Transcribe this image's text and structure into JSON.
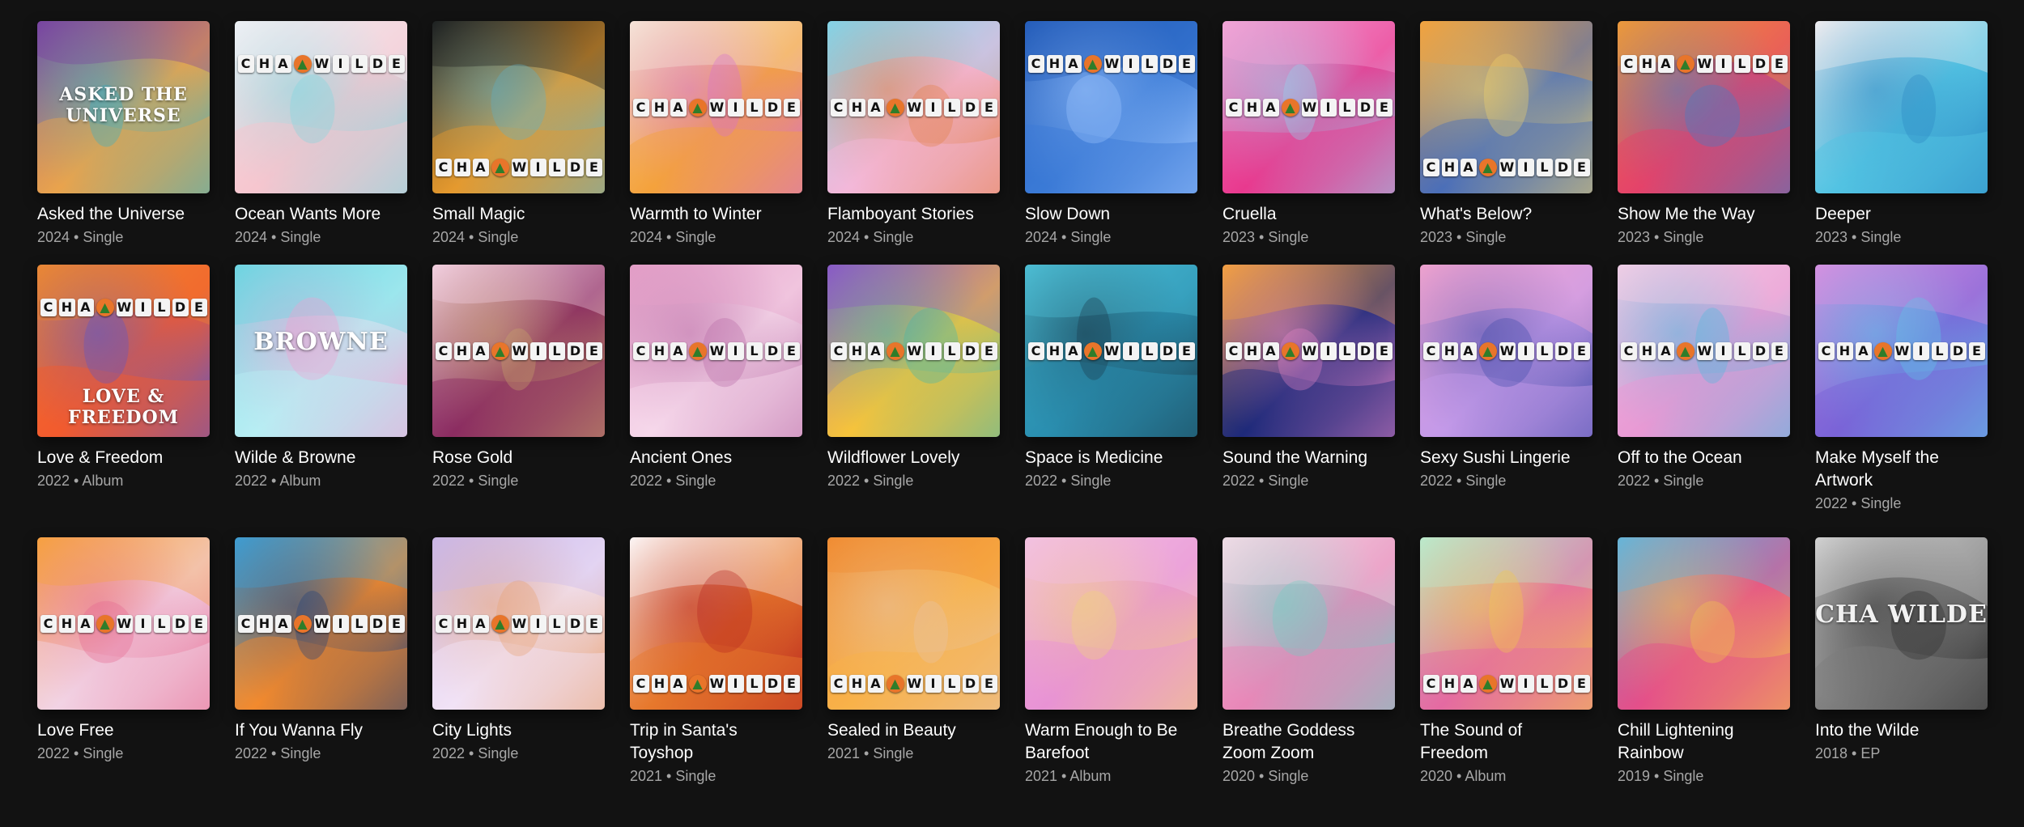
{
  "brand_logo_letters": [
    "C",
    "H",
    "A",
    "",
    "W",
    "I",
    "L",
    "D",
    "E"
  ],
  "albums": [
    {
      "title": "Asked the Universe",
      "meta": "2024 • Single",
      "art": {
        "c1": "#7b3fa0",
        "c2": "#e9a34d",
        "c3": "#35b3c9",
        "logo": false,
        "cover_text": "ASKED THE UNIVERSE"
      }
    },
    {
      "title": "Ocean Wants More",
      "meta": "2024 • Single",
      "art": {
        "c1": "#f2f2f5",
        "c2": "#f6c6cf",
        "c3": "#7fd7df",
        "logo": "top"
      }
    },
    {
      "title": "Small Magic",
      "meta": "2024 • Single",
      "art": {
        "c1": "#1b1b1b",
        "c2": "#e59a2f",
        "c3": "#5fb3c9",
        "logo": "bottom"
      }
    },
    {
      "title": "Warmth to Winter",
      "meta": "2024 • Single",
      "art": {
        "c1": "#f7e9d9",
        "c2": "#f4a23c",
        "c3": "#d66fd2",
        "logo": "mid"
      }
    },
    {
      "title": "Flamboyant Stories",
      "meta": "2024 • Single",
      "art": {
        "c1": "#7fd7ee",
        "c2": "#f3b8d9",
        "c3": "#e27f46",
        "logo": "mid"
      }
    },
    {
      "title": "Slow Down",
      "meta": "2024 • Single",
      "art": {
        "c1": "#1f58b6",
        "c2": "#3b7bd6",
        "c3": "#9ec6ff",
        "logo": "top"
      }
    },
    {
      "title": "Cruella",
      "meta": "2023 • Single",
      "art": {
        "c1": "#f6a2d6",
        "c2": "#e8398f",
        "c3": "#8fd6f0",
        "logo": "mid"
      }
    },
    {
      "title": "What's Below?",
      "meta": "2023 • Single",
      "art": {
        "c1": "#f2a13d",
        "c2": "#4c6fb8",
        "c3": "#f4d56a",
        "logo": "bottom"
      }
    },
    {
      "title": "Show Me the Way",
      "meta": "2023 • Single",
      "art": {
        "c1": "#f39a35",
        "c2": "#e4436a",
        "c3": "#3f7fc8",
        "logo": "top"
      }
    },
    {
      "title": "Deeper",
      "meta": "2023 • Single",
      "art": {
        "c1": "#f7f0f2",
        "c2": "#53c3e3",
        "c3": "#2a86c2",
        "logo": false
      }
    },
    {
      "title": "Love & Freedom",
      "meta": "2022 • Album",
      "art": {
        "c1": "#f08a2e",
        "c2": "#f25b2e",
        "c3": "#5b57c9",
        "logo": "top",
        "cover_text": "LOVE & FREEDOM"
      }
    },
    {
      "title": "Wilde & Browne",
      "meta": "2022 • Album",
      "art": {
        "c1": "#67d8e2",
        "c2": "#b8eef3",
        "c3": "#f0a0d2",
        "logo": false,
        "cover_text": "BROWNE"
      }
    },
    {
      "title": "Rose Gold",
      "meta": "2022 • Single",
      "art": {
        "c1": "#f3d1e4",
        "c2": "#8b2d61",
        "c3": "#c8a56a",
        "logo": "mid"
      }
    },
    {
      "title": "Ancient Ones",
      "meta": "2022 • Single",
      "art": {
        "c1": "#e4a0c8",
        "c2": "#f6d8ea",
        "c3": "#b86aa5",
        "logo": "mid"
      }
    },
    {
      "title": "Wildflower Lovely",
      "meta": "2022 • Single",
      "art": {
        "c1": "#8b56c8",
        "c2": "#f6c33b",
        "c3": "#3fb7b0",
        "logo": "mid"
      }
    },
    {
      "title": "Space is Medicine",
      "meta": "2022 • Single",
      "art": {
        "c1": "#4fc3d9",
        "c2": "#2a8fb0",
        "c3": "#1b3a4a",
        "logo": "mid"
      }
    },
    {
      "title": "Sound the Warning",
      "meta": "2022 • Single",
      "art": {
        "c1": "#f3a13d",
        "c2": "#1e2a7a",
        "c3": "#e886c8",
        "logo": "mid"
      }
    },
    {
      "title": "Sexy Sushi Lingerie",
      "meta": "2022 • Single",
      "art": {
        "c1": "#f6a6d0",
        "c2": "#c49ae8",
        "c3": "#3f4aa8",
        "logo": "mid"
      }
    },
    {
      "title": "Off to the Ocean",
      "meta": "2022 • Single",
      "art": {
        "c1": "#f6cfe6",
        "c2": "#e89ad4",
        "c3": "#4cb9df",
        "logo": "mid"
      }
    },
    {
      "title": "Make Myself the Artwork",
      "meta": "2022 • Single",
      "art": {
        "c1": "#d98fe0",
        "c2": "#7a63d8",
        "c3": "#5ec8e8",
        "logo": "mid"
      }
    },
    {
      "title": "Love Free",
      "meta": "2022 • Single",
      "art": {
        "c1": "#f7a23d",
        "c2": "#f2d3e4",
        "c3": "#e6668e",
        "logo": "mid"
      }
    },
    {
      "title": "If You Wanna Fly",
      "meta": "2022 • Single",
      "art": {
        "c1": "#3fa1d6",
        "c2": "#f28a2e",
        "c3": "#1e3f7a",
        "logo": "mid"
      }
    },
    {
      "title": "City Lights",
      "meta": "2022 • Single",
      "art": {
        "c1": "#c9b7ec",
        "c2": "#f1e3f6",
        "c3": "#e7a06f",
        "logo": "mid"
      }
    },
    {
      "title": "Trip in Santa's Toyshop",
      "meta": "2021 • Single",
      "art": {
        "c1": "#ffffff",
        "c2": "#e6782c",
        "c3": "#b8241f",
        "logo": "bottom"
      }
    },
    {
      "title": "Sealed in Beauty",
      "meta": "2021 • Single",
      "art": {
        "c1": "#f08a2e",
        "c2": "#f8b24a",
        "c3": "#e7c4a6",
        "logo": "bottom"
      }
    },
    {
      "title": "Warm Enough to Be Barefoot",
      "meta": "2021 • Album",
      "art": {
        "c1": "#f3c1e6",
        "c2": "#e893d4",
        "c3": "#f2d37a",
        "logo": false
      }
    },
    {
      "title": "Breathe Goddess Zoom Zoom",
      "meta": "2020 • Single",
      "art": {
        "c1": "#f4dde7",
        "c2": "#e887b9",
        "c3": "#6fcfc2",
        "logo": false
      }
    },
    {
      "title": "The Sound of Freedom",
      "meta": "2020 • Album",
      "art": {
        "c1": "#b8ecd2",
        "c2": "#e46aa2",
        "c3": "#f4c84a",
        "logo": "bottom"
      }
    },
    {
      "title": "Chill Lightening Rainbow",
      "meta": "2019 • Single",
      "art": {
        "c1": "#5fb4e0",
        "c2": "#e44f8a",
        "c3": "#f3c64a",
        "logo": false
      }
    },
    {
      "title": "Into the Wilde",
      "meta": "2018 • EP",
      "art": {
        "c1": "#d9d9d9",
        "c2": "#7d7d7d",
        "c3": "#2b2b2b",
        "logo": false,
        "cover_text": "CHA WILDE"
      }
    }
  ]
}
